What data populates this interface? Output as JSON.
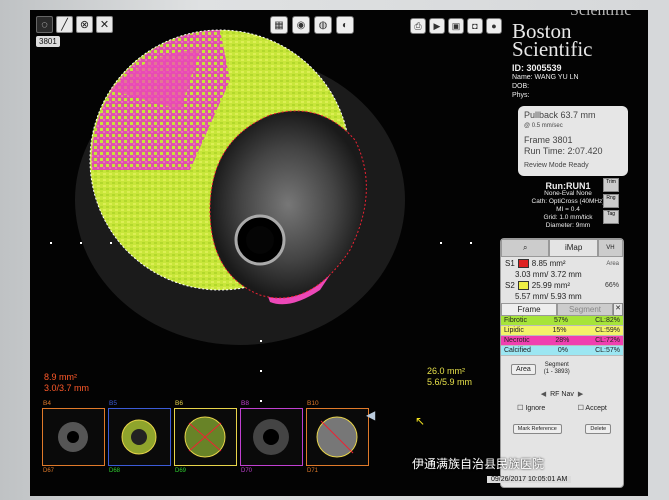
{
  "toolbar": {
    "frame_label": "3801"
  },
  "brand": {
    "line1": "Boston",
    "line2": "Scientific",
    "top_partial": "Scientific"
  },
  "patient": {
    "id": "ID: 3005539",
    "name": "Name: WANG YU LN",
    "dob": "DOB:",
    "phys": "Phys:"
  },
  "pullback": {
    "length": "Pullback 63.7 mm",
    "speed": "@ 0.5 mm/sec",
    "frame": "Frame 3801",
    "runtime": "Run Time: 2:07.420",
    "status": "Review Mode Ready"
  },
  "run": {
    "name": "Run:RUN1",
    "eval": "None-Eval None",
    "cath": "Cath: OptiCross (40MHz)",
    "ml": "MI = 0.4",
    "grid": "Grid:  1.0 mm/tick",
    "diameter": "Diameter:  9mm"
  },
  "side_buttons": [
    "Trim",
    "Rng",
    "Tag"
  ],
  "panel": {
    "tab_main": "",
    "tab_imap": "iMap",
    "tab_vh": "VH",
    "s1_label": "S1",
    "s1_area": "8.85 mm²",
    "s1_diam": "3.03 mm/ 3.72 mm",
    "area_hdr": "Area",
    "area_pct": "66%",
    "s2_label": "S2",
    "s2_area": "25.99 mm²",
    "s2_diam": "5.57 mm/ 5.93 mm",
    "frame_tab": "Frame",
    "segment_tab": "Segment",
    "tissue": [
      {
        "name": "Fibrotic",
        "pct": "57%",
        "cl": "CL:82%",
        "color": "#a6e43a"
      },
      {
        "name": "Lipidic",
        "pct": "15%",
        "cl": "CL:59%",
        "color": "#f3f36a"
      },
      {
        "name": "Necrotic",
        "pct": "28%",
        "cl": "CL:72%",
        "color": "#f040b0"
      },
      {
        "name": "Calcified",
        "pct": "0%",
        "cl": "CL:57%",
        "color": "#9ce6f2"
      }
    ],
    "area_btn": "Area",
    "segment_label": "Segment",
    "segment_range": "(1 - 3893)",
    "rf_nav": "RF Nav",
    "ignore": "Ignore",
    "accept": "Accept",
    "mark_ref": "Mark Reference",
    "delete": "Delete"
  },
  "measurements_left": {
    "area": "8.9 mm²",
    "diam": "3.0/3.7 mm"
  },
  "measurements_right": {
    "area": "26.0 mm²",
    "diam": "5.6/5.9 mm"
  },
  "thumbs": [
    {
      "label": "B4",
      "foot": "D67",
      "color": "#e07a2a"
    },
    {
      "label": "B5",
      "foot": "D68",
      "color": "#3b5bd8"
    },
    {
      "label": "B6",
      "foot": "D69",
      "color": "#e8d44a"
    },
    {
      "label": "B8",
      "foot": "D70",
      "color": "#c040d0"
    },
    {
      "label": "B10",
      "foot": "D71",
      "color": "#e07a2a"
    }
  ],
  "watermark": "伊通满族自治县民族医院",
  "datetime": "09/26/2017 10:05:01 AM"
}
